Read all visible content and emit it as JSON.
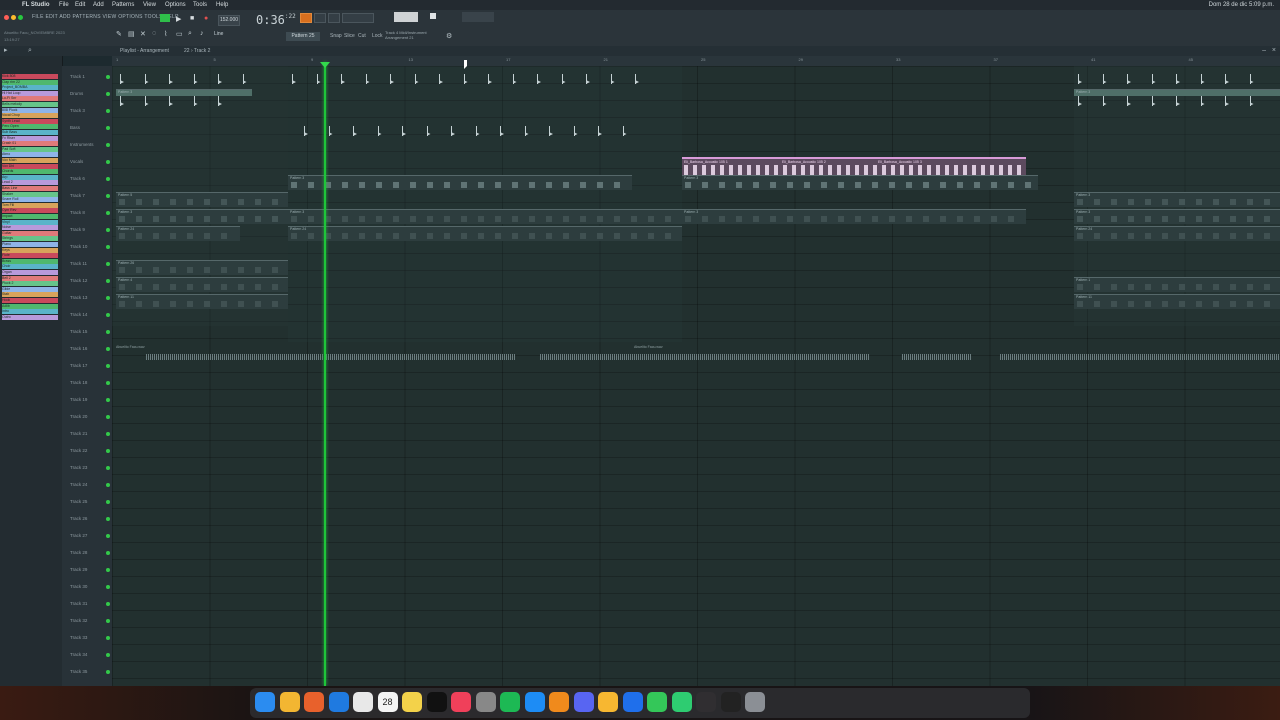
{
  "menubar": {
    "app": "FL Studio",
    "items": [
      "File",
      "Edit",
      "Add",
      "Patterns",
      "View",
      "Options",
      "Tools",
      "Help"
    ],
    "clock": "Dom 28 de dic 5:09 p.m."
  },
  "toolbar": {
    "fl_menu": "FILE EDIT ADD PATTERNS VIEW OPTIONS TOOLS HELP",
    "project_hint": "Abuelito Facu_NOVIEMBRE 2023",
    "hint2": "13:19:27",
    "time_main": "0:36",
    "time_sub": ":22",
    "tempo": "152.000",
    "pattern": "Pattern 25",
    "line_label": "Line",
    "tool_labels": [
      "Snap",
      "Slice",
      "Cut",
      "Lock"
    ],
    "hint_line1": "Track 4 Midi/Instrument",
    "hint_line2": "Arrangement 21"
  },
  "playlist": {
    "title": "Playlist - Arrangement",
    "breadcrumb": "22 › Track 2"
  },
  "browser": {
    "items": [
      "Kick 808",
      "Clap rim 22",
      "Project_BOMBA",
      "Hi Hat Loop",
      "Lo-Fi Snr",
      "Bells melody",
      "808 Pluck",
      "Vocal Chop",
      "Synth Lead",
      "Perc Open",
      "Sub Bass",
      "Fx Riser",
      "Crash 01",
      "Pad Soft",
      "Atmo",
      "Vox Main",
      "Vox Dbl",
      "Chords",
      "Arp",
      "Lead 2",
      "Bass Line",
      "Shaker",
      "Snare Roll",
      "Tom Fill",
      "Cym Rev",
      "Impact",
      "Vinyl",
      "Noise",
      "Guitar",
      "Strings",
      "Piano",
      "Keys",
      "Flute",
      "Brass",
      "Choir",
      "Organ",
      "Bell 2",
      "Pluck 2",
      "Glide",
      "Stab",
      "Hook",
      "Adlib",
      "Intro",
      "Outro"
    ]
  },
  "tracks": [
    {
      "label": "Track 1"
    },
    {
      "label": "Drums"
    },
    {
      "label": "Track 3"
    },
    {
      "label": "Bass"
    },
    {
      "label": "Instruments"
    },
    {
      "label": "Vocals"
    },
    {
      "label": "Track 6"
    },
    {
      "label": "Track 7"
    },
    {
      "label": "Track 8"
    },
    {
      "label": "Track 9"
    },
    {
      "label": "Track 10"
    },
    {
      "label": "Track 11"
    },
    {
      "label": "Track 12"
    },
    {
      "label": "Track 13"
    },
    {
      "label": "Track 14"
    },
    {
      "label": "Track 15"
    },
    {
      "label": "Track 16"
    },
    {
      "label": "Track 17"
    },
    {
      "label": "Track 18"
    },
    {
      "label": "Track 19"
    },
    {
      "label": "Track 20"
    },
    {
      "label": "Track 21"
    },
    {
      "label": "Track 22"
    },
    {
      "label": "Track 23"
    },
    {
      "label": "Track 24"
    },
    {
      "label": "Track 25"
    },
    {
      "label": "Track 26"
    },
    {
      "label": "Track 27"
    },
    {
      "label": "Track 28"
    },
    {
      "label": "Track 29"
    },
    {
      "label": "Track 30"
    },
    {
      "label": "Track 31"
    },
    {
      "label": "Track 32"
    },
    {
      "label": "Track 33"
    },
    {
      "label": "Track 34"
    },
    {
      "label": "Track 35"
    },
    {
      "label": "Track 36"
    }
  ],
  "ruler": {
    "bars": [
      "1",
      "5",
      "9",
      "13",
      "17",
      "21",
      "25",
      "29",
      "33",
      "37",
      "41",
      "45"
    ]
  },
  "clips": {
    "drums_a": "Pattern 3",
    "drums_b": "Pattern 3",
    "pattern5": "Pattern 5",
    "pattern3": "Pattern 3",
    "pattern24": "Pattern 24",
    "pattern26": "Pattern 26",
    "pattern4": "Pattern 4",
    "pattern1": "Pattern 1",
    "pattern11": "Pattern 11",
    "pink1": "Eli_Barbosa_Acoustic 105 1",
    "pink2": "Eli_Barbosa_Acoustic 105 2",
    "pink3": "Eli_Barbosa_Acoustic 105 3",
    "audio_a": "Abuelito Facu.wav",
    "audio_b": "Abuelito Facu.wav"
  },
  "dock": {
    "apps": [
      "finder",
      "chrome",
      "firefox",
      "safari",
      "photos",
      "calendar",
      "notes",
      "tv",
      "music",
      "settings",
      "spotify",
      "app-store",
      "fl-studio",
      "discord",
      "sketch",
      "keynote",
      "messages",
      "facetime",
      "obs",
      "ableton",
      "trash"
    ],
    "calendar_day": "28"
  }
}
